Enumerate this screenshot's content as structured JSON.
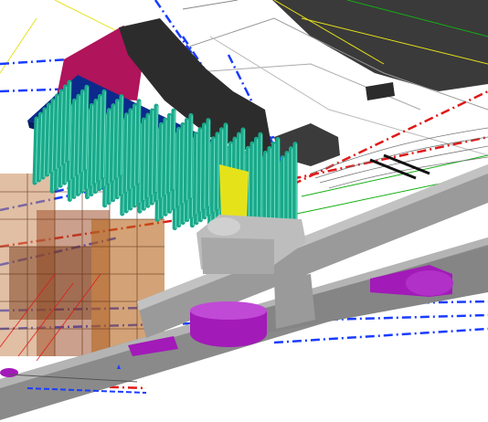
{
  "scene": {
    "description_visible_text": "",
    "colors": {
      "background": "#ffffff",
      "pile": "#1aa88a",
      "pile_cap": "#0b2a8c",
      "magenta_block": "#b0145a",
      "dark_block": "#2a2a2a",
      "pipe": "#8f8f8f",
      "pipe_light": "#bdbdbd",
      "purple_fitting": "#a21ab8",
      "yellow_element": "#e6e21a",
      "blue_dashed": "#1a3cff",
      "red_dashed": "#e01818",
      "green_line": "#12b012",
      "brown_structure": "#a0522d"
    }
  }
}
